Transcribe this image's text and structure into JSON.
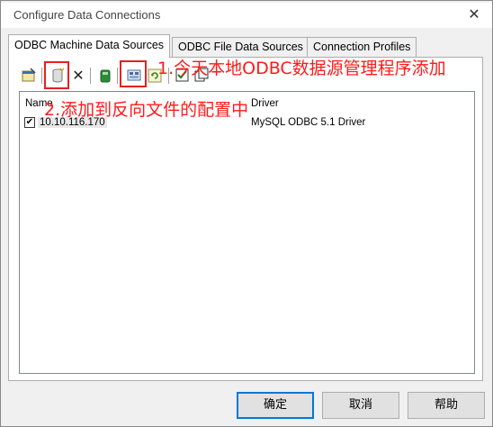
{
  "window": {
    "title": "Configure Data Connections",
    "close_glyph": "✕"
  },
  "tabs": [
    {
      "label": "ODBC Machine Data Sources",
      "active": true
    },
    {
      "label": "ODBC File Data Sources",
      "active": false
    },
    {
      "label": "Connection Profiles",
      "active": false
    }
  ],
  "toolbar": {
    "icons": [
      "properties-icon",
      "add-data-source-icon",
      "delete-icon",
      "test-connection-icon",
      "odbc-admin-icon",
      "refresh-icon",
      "select-all-icon",
      "copy-icon"
    ],
    "delete_glyph": "✕"
  },
  "annotations": {
    "step1": "1.今天本地ODBC数据源管理程序添加",
    "step2": "2.添加到反向文件的配置中"
  },
  "list": {
    "columns": [
      "Name",
      "Driver"
    ],
    "rows": [
      {
        "checked": true,
        "name": "10.10.116.170",
        "driver": "MySQL ODBC 5.1 Driver"
      }
    ]
  },
  "buttons": {
    "ok": "确定",
    "cancel": "取消",
    "help": "帮助"
  },
  "colors": {
    "annotation": "#ff1a1a",
    "highlight_box": "#e62020",
    "default_button_border": "#0078d7"
  }
}
